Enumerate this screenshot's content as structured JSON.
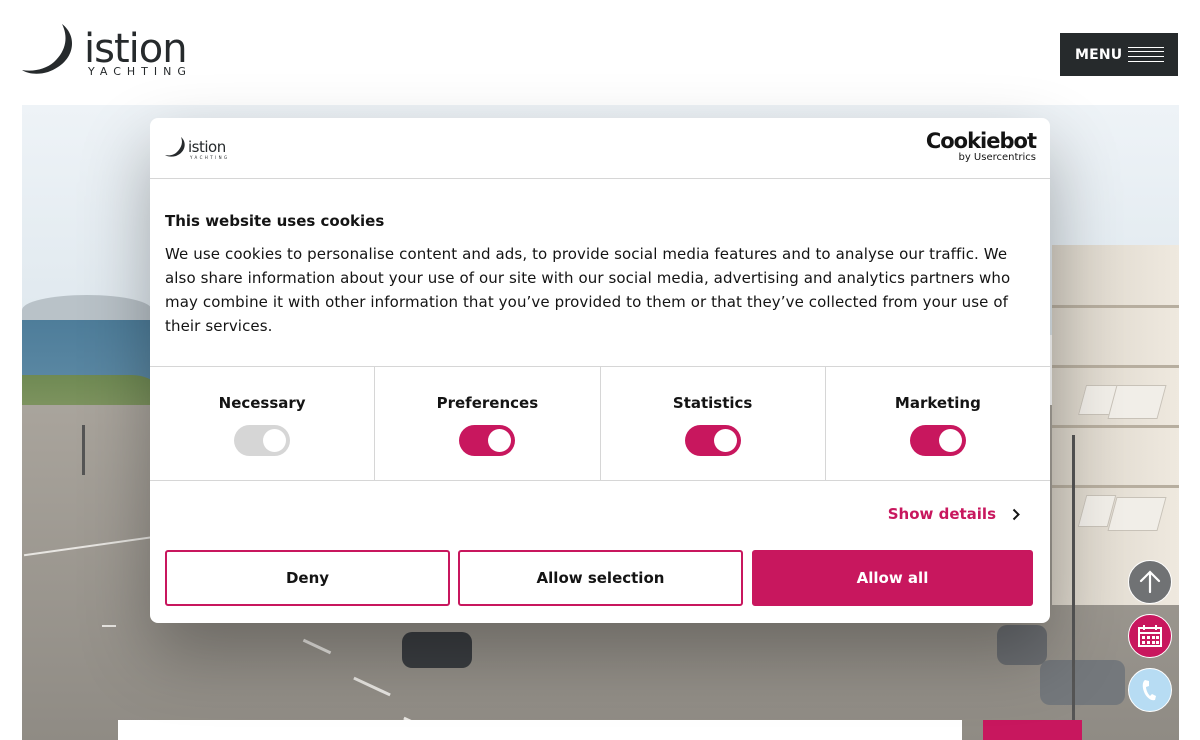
{
  "header": {
    "logo_name": "istion",
    "logo_tagline": "YACHTING",
    "menu_label": "MENU"
  },
  "cookie_dialog": {
    "logo_name": "istion",
    "logo_tagline": "YACHTING",
    "provider_name": "Cookiebot",
    "provider_sub": "by Usercentrics",
    "title": "This website uses cookies",
    "body": "We use cookies to personalise content and ads, to provide social media features and to analyse our traffic. We also share information about your use of our site with our social media, advertising and analytics partners who may combine it with other information that you’ve provided to them or that they’ve collected from your use of their services.",
    "categories": [
      {
        "label": "Necessary",
        "enabled": true,
        "disabled": true
      },
      {
        "label": "Preferences",
        "enabled": true,
        "disabled": false
      },
      {
        "label": "Statistics",
        "enabled": true,
        "disabled": false
      },
      {
        "label": "Marketing",
        "enabled": true,
        "disabled": false
      }
    ],
    "show_details_label": "Show details",
    "buttons": {
      "deny": "Deny",
      "allow_selection": "Allow selection",
      "allow_all": "Allow all"
    }
  },
  "floating_buttons": [
    {
      "icon": "arrow-up-icon"
    },
    {
      "icon": "calendar-icon"
    },
    {
      "icon": "phone-icon"
    }
  ],
  "colors": {
    "accent": "#c8175e",
    "menu_bg": "#262a2c",
    "toggle_disabled": "#d6d6d6"
  }
}
